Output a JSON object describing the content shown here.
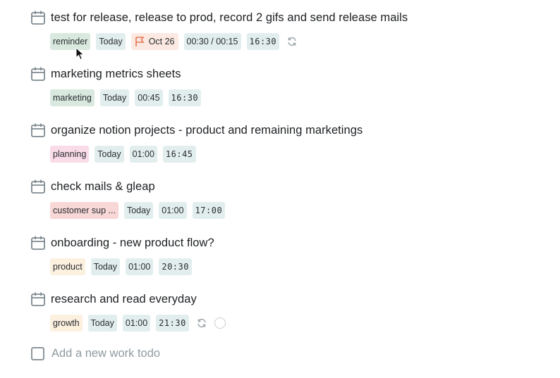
{
  "colors": {
    "chip_default": "#e2eeee",
    "chip_reminder": "#d9e9df",
    "chip_marketing": "#d9e9df",
    "chip_planning": "#fadbe8",
    "chip_customer_support": "#f8d7d7",
    "chip_product": "#fcf0df",
    "chip_growth": "#fcf0df",
    "chip_flag": "#fbe9e2",
    "flag_icon": "#e57a55",
    "icon_gray": "#7e8a90"
  },
  "tasks": [
    {
      "title": "test for release, release to prod, record 2 gifs and send release mails",
      "tag": "reminder",
      "day": "Today",
      "flag_date": "Oct 26",
      "duration": "00:30 / 00:15",
      "time": "16:30",
      "icons": [
        "repeat-icon"
      ]
    },
    {
      "title": "marketing metrics sheets",
      "tag": "marketing",
      "day": "Today",
      "duration": "00:45",
      "time": "16:30"
    },
    {
      "title": "organize notion projects - product and remaining marketings",
      "tag": "planning",
      "day": "Today",
      "duration": "01:00",
      "time": "16:45"
    },
    {
      "title": "check mails & gleap",
      "tag": "customer sup ...",
      "day": "Today",
      "duration": "01:00",
      "time": "17:00"
    },
    {
      "title": "onboarding - new product flow?",
      "tag": "product",
      "day": "Today",
      "duration": "01:00",
      "time": "20:30"
    },
    {
      "title": "research and read everyday",
      "tag": "growth",
      "day": "Today",
      "duration": "01:00",
      "time": "21:30",
      "icons": [
        "repeat-icon",
        "circle-icon"
      ]
    }
  ],
  "add_todo": {
    "placeholder": "Add a new work todo"
  }
}
